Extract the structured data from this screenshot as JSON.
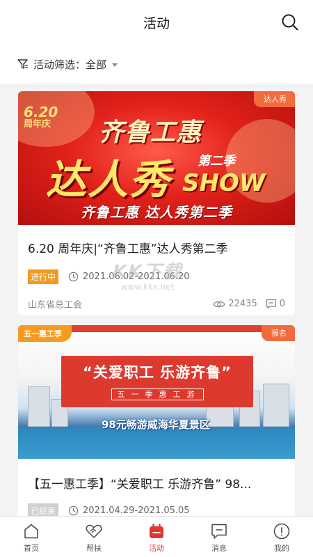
{
  "header": {
    "title": "活动"
  },
  "filter": {
    "label": "活动筛选：",
    "value": "全部"
  },
  "cards": [
    {
      "corner_tag": "达人秀",
      "banner": {
        "date_badge": "6.20",
        "date_badge_sub": "周年庆",
        "line1": "齐鲁工惠",
        "line2": "达人秀",
        "season": "第二季",
        "show": "SHOW",
        "subtitle": "齐鲁工惠 达人秀第二季"
      },
      "title": "6.20 周年庆|“齐鲁工惠”达人秀第二季",
      "status": "进行中",
      "date_range": "2021.06.02-2021.06.20",
      "organizer": "山东省总工会",
      "views": "22435",
      "comments": "0"
    },
    {
      "corner_tag": "报名",
      "banner": {
        "label": "五一惠工季",
        "headline": "“关爱职工 乐游齐鲁”",
        "sub": "五一季惠工游",
        "caption": "98元畅游威海华夏景区"
      },
      "title": "【五一惠工季】“关爱职工 乐游齐鲁” 98...",
      "status": "已结束",
      "date_range": "2021.04.29-2021.05.05"
    }
  ],
  "watermark": {
    "main": "KK下载",
    "url": "www.kkx.net"
  },
  "tabbar": [
    {
      "label": "首页",
      "icon": "home-icon"
    },
    {
      "label": "帮扶",
      "icon": "handshake-icon"
    },
    {
      "label": "活动",
      "icon": "activity-icon",
      "active": true
    },
    {
      "label": "消息",
      "icon": "message-icon"
    },
    {
      "label": "我的",
      "icon": "profile-icon"
    }
  ],
  "colors": {
    "accent": "#e2352b",
    "status_active": "#f29b1e",
    "status_ended": "#cfcfcf"
  }
}
